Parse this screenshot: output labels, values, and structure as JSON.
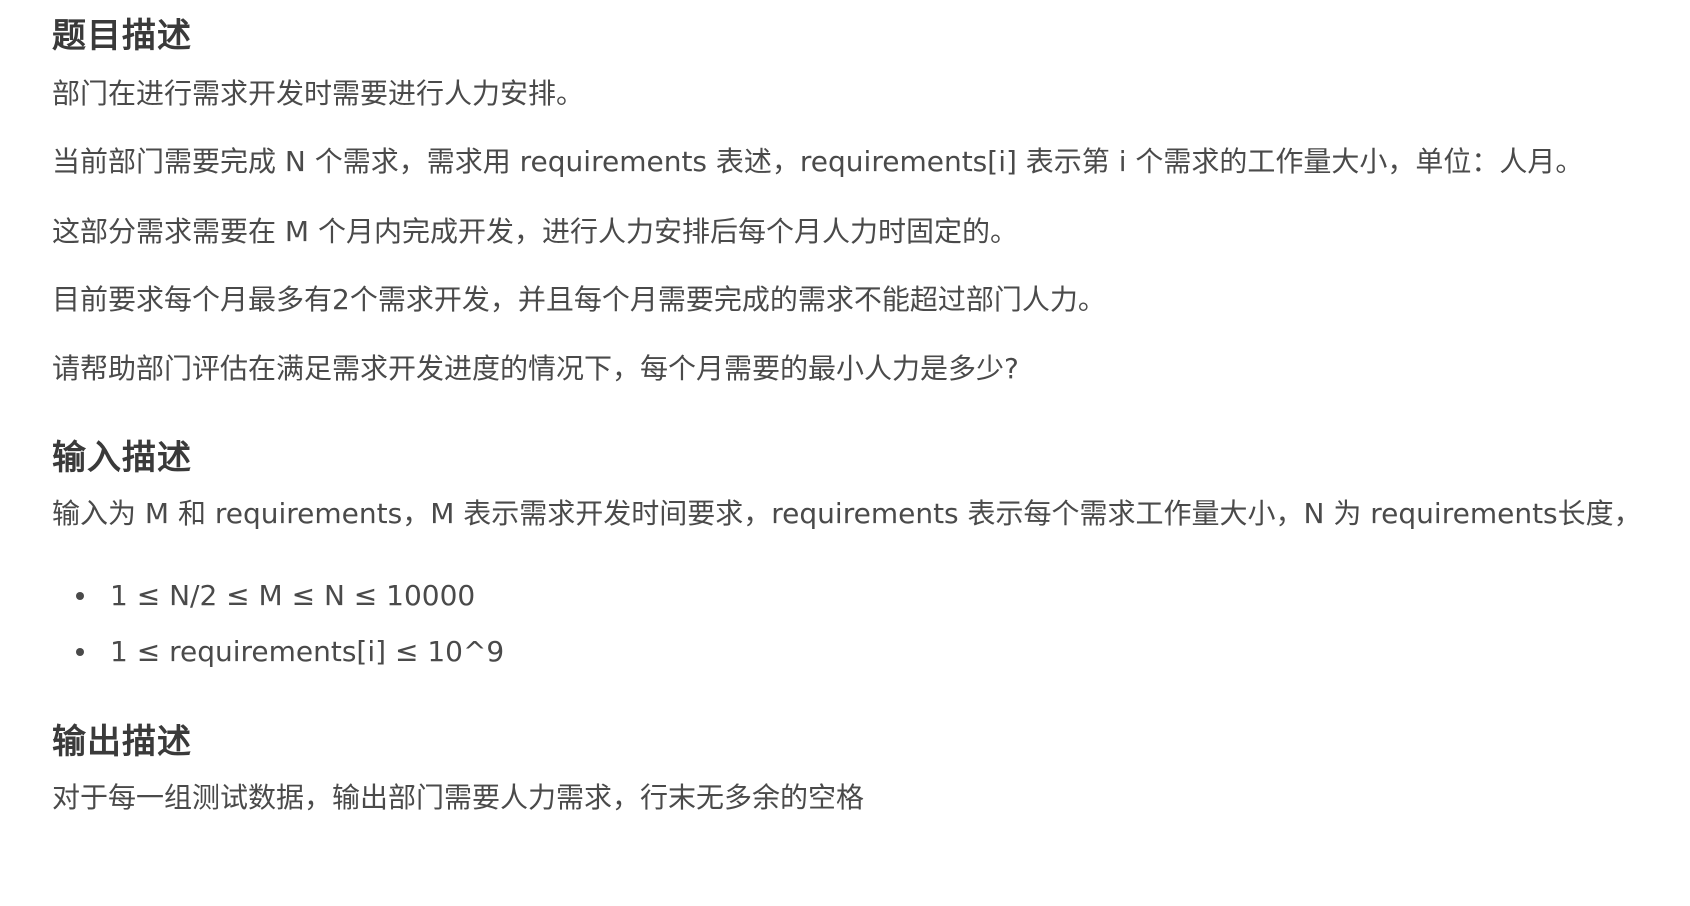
{
  "sections": {
    "description": {
      "title": "题目描述",
      "paragraphs": [
        "部门在进行需求开发时需要进行人力安排。",
        "当前部门需要完成 N 个需求，需求用 requirements 表述，requirements[i] 表示第 i 个需求的工作量大小，单位：人月。",
        "这部分需求需要在 M 个月内完成开发，进行人力安排后每个月人力时固定的。",
        "目前要求每个月最多有2个需求开发，并且每个月需要完成的需求不能超过部门人力。",
        "请帮助部门评估在满足需求开发进度的情况下，每个月需要的最小人力是多少?"
      ]
    },
    "input": {
      "title": "输入描述",
      "paragraph": "输入为 M 和 requirements，M 表示需求开发时间要求，requirements 表示每个需求工作量大小，N 为 requirements长度，",
      "bullets": [
        "1 ≤ N/2 ≤ M ≤ N ≤ 10000",
        "1 ≤ requirements[i] ≤ 10^9"
      ]
    },
    "output": {
      "title": "输出描述",
      "paragraph": "对于每一组测试数据，输出部门需要人力需求，行末无多余的空格"
    }
  }
}
